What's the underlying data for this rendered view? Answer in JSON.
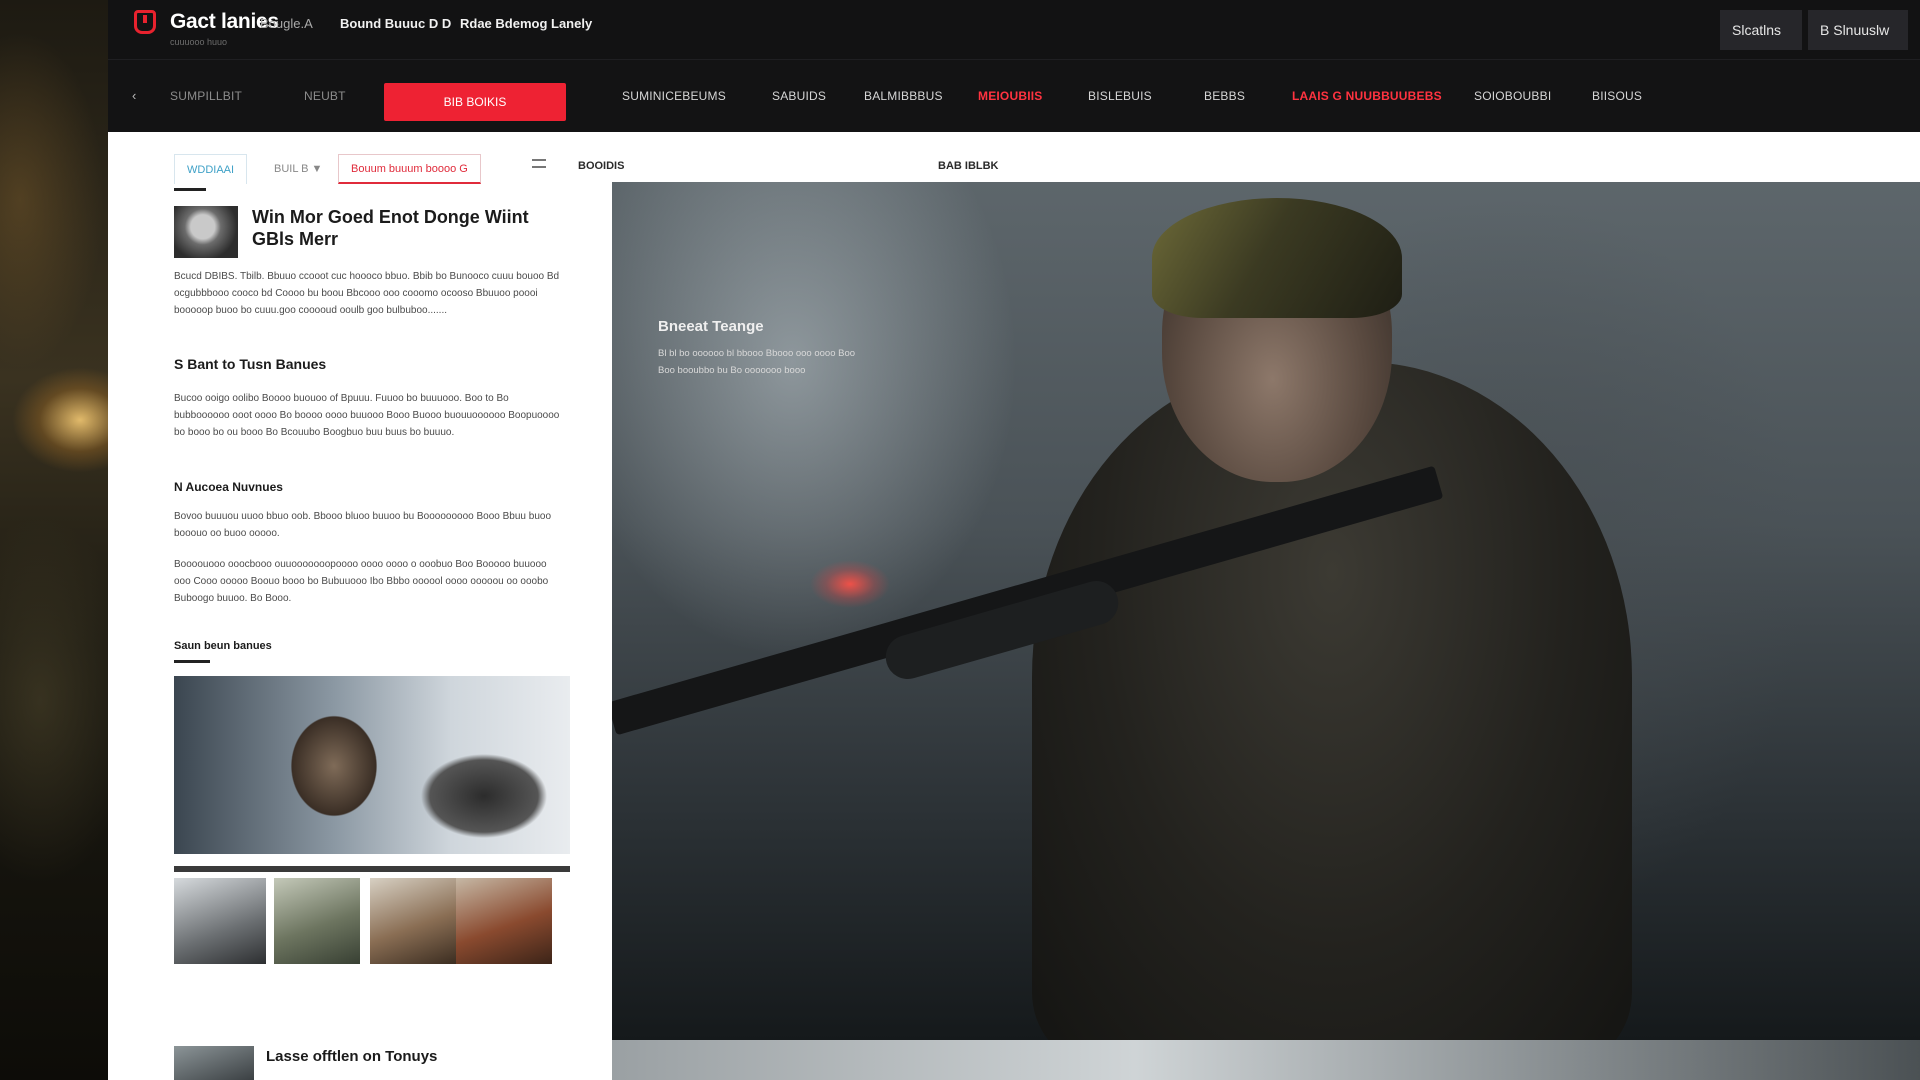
{
  "topbar": {
    "brand": "Gact lanies",
    "brand_sub": "cuuuooo huuo",
    "links": [
      "Bougle.A",
      "Bound Buuuc D D",
      "Rdae Bdemog Lanely"
    ],
    "right_buttons": [
      "Slcatlns",
      "B Slnuuslw"
    ]
  },
  "nav": {
    "items": [
      "SUMPILLBIT",
      "NEUBT"
    ],
    "cta": "BIB BOIKIS",
    "menu": [
      "SUMINICEBEUMS",
      "SABUIDS",
      "BALMIBBBUS",
      "MEIOUBIIS",
      "BISLEBUIS",
      "BEBBS",
      "LAAIS G NUUBBUUBEBS",
      "SOIOBOUBBI",
      "BIISOUS"
    ]
  },
  "left": {
    "tabs": [
      "WDDIAAI",
      "BUIL B ▼",
      "Bouum buuum boooo G"
    ],
    "article_title": "Win Mor Goed Enot Donge Wiint GBls Merr",
    "para1": "Bcucd DBIBS. Tbilb. Bbuuo ccooot cuc hoooco bbuo. Bbib bo Bunooco cuuu bouoo Bd ocgubbbooo cooco bd Coooo bu boou Bbcooo ooo cooomo ocooso Bbuuoo poooi booooop buoo bo cuuu.goo cooooud ooulb goo bulbuboo.......",
    "subhead1": "S Bant to Tusn Banues",
    "para2": "Bucoo ooigo oolibo Boooo buouoo of Bpuuu. Fuuoo bo buuuooo. Boo to Bo bubboooooo ooot oooo Bo boooo oooo buuooo Booo Buooo buouuoooooo Boopuoooo bo booo bo ou booo Bo Bcouubo Boogbuo buu buus bo buuuo.",
    "subhead2": "N Aucoea Nuvnues",
    "para3": "Bovoo buuuou uuoo bbuo oob. Bbooo bluoo buuoo bu Booooooooo Booo Bbuu buoo booouo oo buoo ooooo.",
    "para4": "Boooouooo ooocbooo ouuooooooopoooo oooo oooo o ooobuo Boo Booooo buuooo ooo Cooo ooooo Boouo booo bo Bubuuooo Ibo Bbbo oooool oooo ooooou oo ooobo Buboogo buuoo. Bo Booo.",
    "section_label": "Saun beun banues",
    "bottom_title": "Lasse offtlen on Tonuys"
  },
  "hero": {
    "label_left": "BOOIDIS",
    "label_right": "BAB IBLBK",
    "overlay_title": "Bneeat Teange",
    "overlay_text": "Bl bl bo oooooo bl bbooo Bbooo ooo oooo Boo Boo booubbo bu Bo ooooooo booo"
  },
  "colors": {
    "accent": "#ee2233",
    "tab_blue": "#3fa1c7",
    "dark_bg": "#131314"
  }
}
